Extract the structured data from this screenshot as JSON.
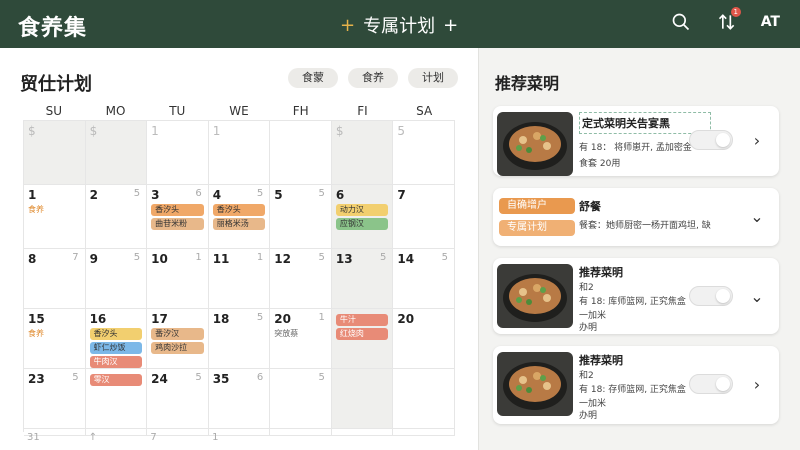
{
  "header": {
    "brand": "食养集",
    "title": "专属计划",
    "plus_left": "+",
    "plus_right": "+",
    "avatar": "AT",
    "badge": "1"
  },
  "calendar": {
    "title": "贸仕计划",
    "filters": [
      "食蒙",
      "食养",
      "计划"
    ],
    "days": [
      "SU",
      "MO",
      "TU",
      "WE",
      "FH",
      "FI",
      "SA"
    ],
    "weeks": [
      [
        {
          "n": "$",
          "muted": true,
          "shade": true
        },
        {
          "n": "$",
          "muted": true,
          "shade": true
        },
        {
          "n": "1",
          "muted": true
        },
        {
          "n": "1",
          "muted": true
        },
        {
          "n": "",
          "muted": true
        },
        {
          "n": "$",
          "muted": true,
          "shade": true
        },
        {
          "n": "5",
          "muted": true
        }
      ],
      [
        {
          "n": "1",
          "sub": "食养"
        },
        {
          "n": "2",
          "n2": "5"
        },
        {
          "n": "3",
          "n2": "6",
          "events": [
            {
              "t": "香汐头",
              "c": "orange"
            },
            {
              "t": "曲苷米粉",
              "c": "tan"
            }
          ]
        },
        {
          "n": "4",
          "n2": "5",
          "events": [
            {
              "t": "香汐头",
              "c": "orange"
            },
            {
              "t": "丽格米汤",
              "c": "tan"
            }
          ]
        },
        {
          "n": "5",
          "n2": "5"
        },
        {
          "n": "6",
          "n2": "",
          "events": [
            {
              "t": "动力汉",
              "c": "yellow"
            },
            {
              "t": "应钢汉",
              "c": "green"
            }
          ],
          "shade": true
        },
        {
          "n": "7"
        }
      ],
      [
        {
          "n": "8",
          "n2": "7"
        },
        {
          "n": "9",
          "n2": "5"
        },
        {
          "n": "10",
          "n2": "1"
        },
        {
          "n": "11",
          "n2": "1"
        },
        {
          "n": "12",
          "n2": "5"
        },
        {
          "n": "13",
          "n2": "5",
          "shade": true
        },
        {
          "n": "14",
          "n2": "5"
        }
      ],
      [
        {
          "n": "15",
          "sub": "食养"
        },
        {
          "n": "16",
          "n2": "",
          "events": [
            {
              "t": "香汐头",
              "c": "yellow"
            },
            {
              "t": "虾仁炒饭",
              "c": "blue"
            },
            {
              "t": "牛肉汉",
              "c": "red"
            }
          ]
        },
        {
          "n": "17",
          "n2": "",
          "events": [
            {
              "t": "番汐汉",
              "c": "tan"
            },
            {
              "t": "鸡肉沙拉",
              "c": "tan"
            }
          ]
        },
        {
          "n": "18",
          "n2": "5"
        },
        {
          "n": "20",
          "n2": "1",
          "sub": "突放蔡",
          "subgray": true
        },
        {
          "n": "",
          "events": [
            {
              "t": "牛汁",
              "c": "red"
            },
            {
              "t": "红烧肉",
              "c": "red"
            }
          ],
          "shade": true
        },
        {
          "n": "20"
        }
      ],
      [
        {
          "n": "23",
          "n2": "5"
        },
        {
          "n": "",
          "events": [
            {
              "t": "零汉",
              "c": "red"
            }
          ]
        },
        {
          "n": "24",
          "n2": "5"
        },
        {
          "n": "35",
          "n2": "6"
        },
        {
          "n": "",
          "n2": "5"
        },
        {
          "n": "",
          "shade": true
        },
        {
          "n": ""
        }
      ]
    ],
    "last_row": [
      "31",
      "↑",
      "7",
      "1",
      "",
      "",
      ""
    ]
  },
  "recommend": {
    "title": "推荐菜明",
    "cards": [
      {
        "title": "定式菜明关告宴黑",
        "line1": "有 18：  将师崽开, 孟加密金",
        "line2": "食套    20用",
        "type": "toggle"
      },
      {
        "tag1": "自确增户",
        "tag2": "专属计划",
        "title": "舒餐",
        "line1": "餐套：她师厨密一杨开面鸡坦, 缺",
        "type": "expand"
      },
      {
        "title": "推荐菜明",
        "line0": "和2",
        "line1": "有 18:    库师篮网, 正究焦盒",
        "line2": "一加米",
        "line3": "办明",
        "type": "toggle-expand"
      },
      {
        "title": "推荐菜明",
        "line0": "和2",
        "line1": "有 18:    存师篮网, 正究焦盒",
        "line2": "一加米",
        "line3": "办明",
        "type": "toggle-arrow"
      }
    ]
  },
  "colors": {
    "header_bg": "#2f4a3a",
    "accent": "#e6b34a",
    "tag_orange": "#e9994f"
  },
  "icons": {
    "search": "search-icon",
    "sort": "sort-icon",
    "chevron_right": "chevron-right-icon",
    "chevron_down": "chevron-down-icon"
  }
}
